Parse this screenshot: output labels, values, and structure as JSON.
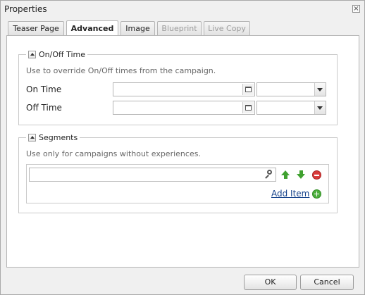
{
  "dialog": {
    "title": "Properties",
    "close_icon": "close-icon"
  },
  "tabs": [
    {
      "label": "Teaser Page",
      "state": "normal"
    },
    {
      "label": "Advanced",
      "state": "active"
    },
    {
      "label": "Image",
      "state": "normal"
    },
    {
      "label": "Blueprint",
      "state": "disabled"
    },
    {
      "label": "Live Copy",
      "state": "disabled"
    }
  ],
  "onoff": {
    "legend": "On/Off Time",
    "hint": "Use to override On/Off times from the campaign.",
    "on_time": {
      "label": "On Time",
      "date": "",
      "time": ""
    },
    "off_time": {
      "label": "Off Time",
      "date": "",
      "time": ""
    }
  },
  "segments": {
    "legend": "Segments",
    "hint": "Use only for campaigns without experiences.",
    "input_value": "",
    "add_item_label": "Add Item"
  },
  "footer": {
    "ok_label": "OK",
    "cancel_label": "Cancel"
  },
  "colors": {
    "link": "#15428b",
    "accent_green": "#3fa12f",
    "remove_red": "#d83a3a"
  }
}
